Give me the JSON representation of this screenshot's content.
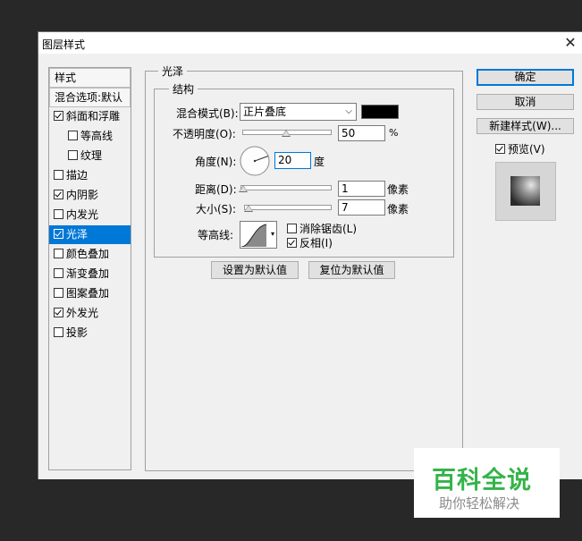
{
  "dialog": {
    "title": "图层样式",
    "close_symbol": "✕"
  },
  "left": {
    "header_styles": "样式",
    "header_blend": "混合选项:默认",
    "items": [
      {
        "label": "斜面和浮雕",
        "checked": true
      },
      {
        "label": "等高线",
        "checked": false
      },
      {
        "label": "纹理",
        "checked": false
      },
      {
        "label": "描边",
        "checked": false
      },
      {
        "label": "内阴影",
        "checked": true
      },
      {
        "label": "内发光",
        "checked": false
      },
      {
        "label": "光泽",
        "checked": true,
        "active": true
      },
      {
        "label": "颜色叠加",
        "checked": false
      },
      {
        "label": "渐变叠加",
        "checked": false
      },
      {
        "label": "图案叠加",
        "checked": false
      },
      {
        "label": "外发光",
        "checked": true
      },
      {
        "label": "投影",
        "checked": false
      }
    ]
  },
  "satin": {
    "group_title": "光泽",
    "struct_title": "结构",
    "blend_mode_label": "混合模式(B):",
    "blend_mode_value": "正片叠底",
    "blend_color": "#000000",
    "opacity_label": "不透明度(O):",
    "opacity_value": "50",
    "opacity_unit": "%",
    "angle_label": "角度(N):",
    "angle_value": "20",
    "angle_unit": "度",
    "distance_label": "距离(D):",
    "distance_value": "1",
    "distance_unit": "像素",
    "size_label": "大小(S):",
    "size_value": "7",
    "size_unit": "像素",
    "contour_label": "等高线:",
    "antialias_label": "消除锯齿(L)",
    "antialias_checked": false,
    "invert_label": "反相(I)",
    "invert_checked": true,
    "set_default": "设置为默认值",
    "reset_default": "复位为默认值"
  },
  "right": {
    "ok": "确定",
    "cancel": "取消",
    "new_style": "新建样式(W)...",
    "preview_label": "预览(V)",
    "preview_checked": true
  },
  "watermark": {
    "title": "百科全说",
    "subtitle": "助你轻松解决",
    "title_color": "#35b34a"
  }
}
